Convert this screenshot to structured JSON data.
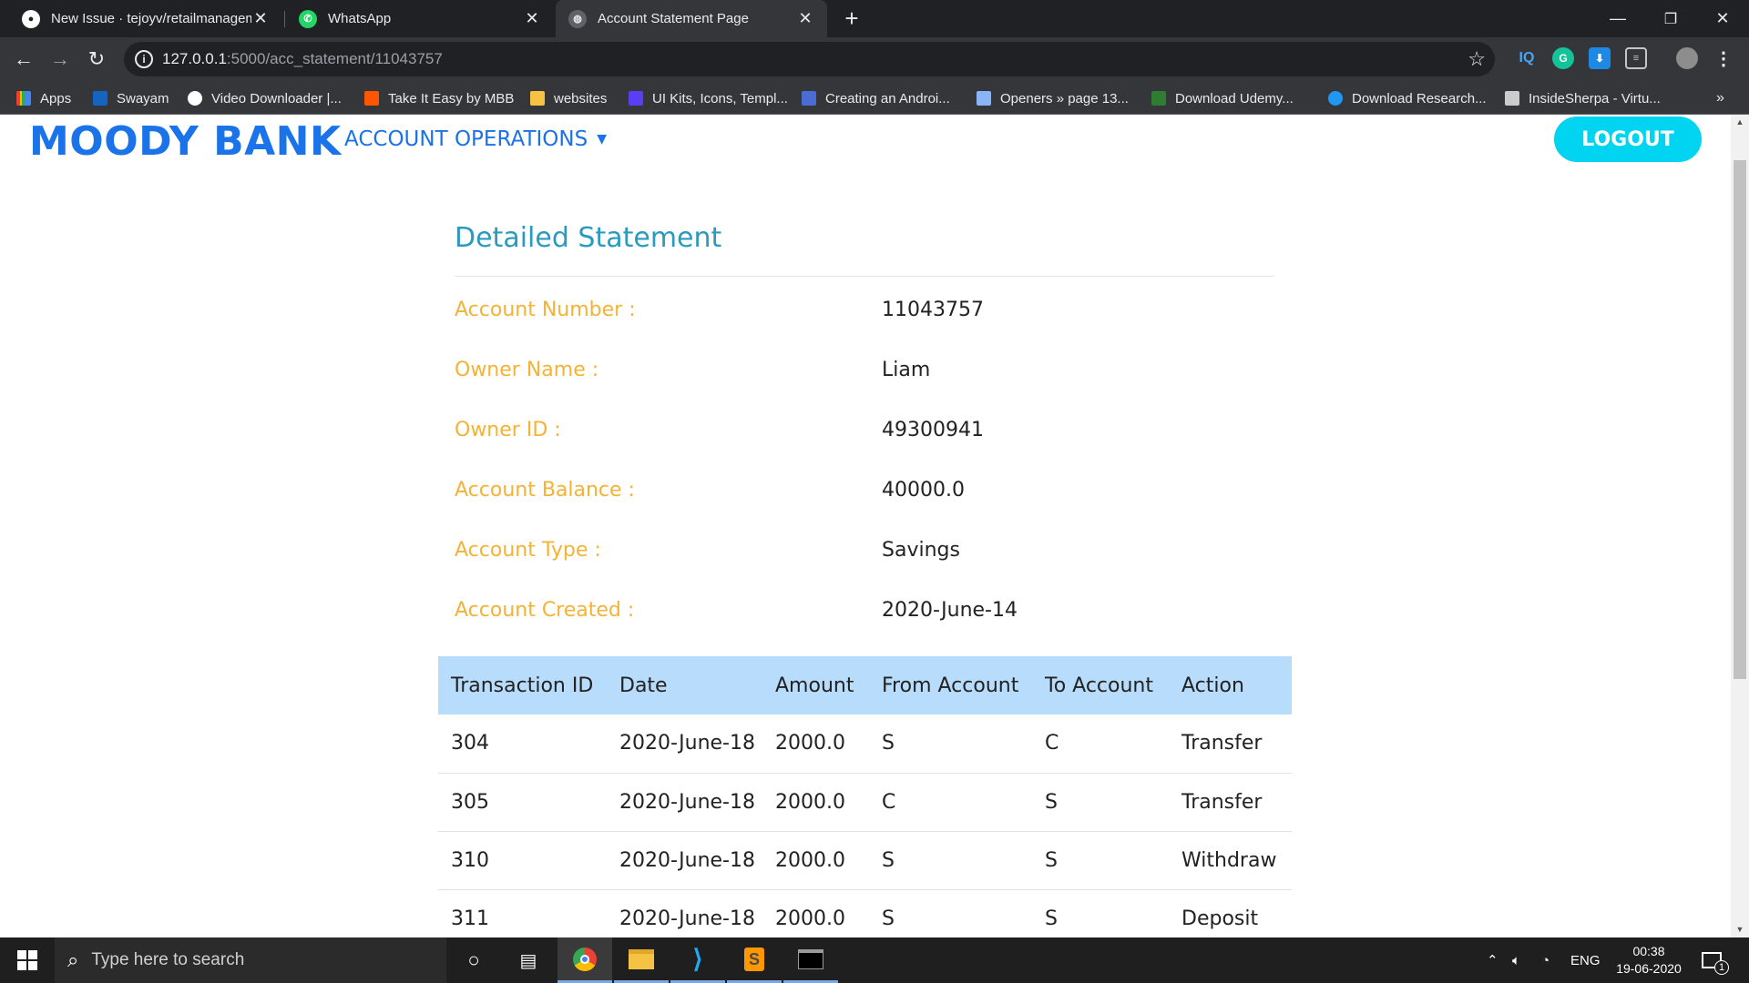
{
  "browser": {
    "tabs": [
      {
        "title": "New Issue · tejoyv/retailmanagem",
        "favicon": "github-icon"
      },
      {
        "title": "WhatsApp",
        "favicon": "whatsapp-icon"
      },
      {
        "title": "Account Statement Page",
        "favicon": "globe-icon",
        "active": true
      }
    ],
    "url_host": "127.0.0.1",
    "url_path": ":5000/acc_statement/11043757",
    "bookmarks": [
      {
        "label": "Apps",
        "color": "#4285f4"
      },
      {
        "label": "Swayam",
        "color": "#1565c0"
      },
      {
        "label": "Video Downloader |...",
        "color": "#ffffff"
      },
      {
        "label": "Take It Easy by MBB",
        "color": "#ff5500"
      },
      {
        "label": "websites",
        "color": "#f6c244"
      },
      {
        "label": "UI Kits, Icons, Templ...",
        "color": "#5b3df5"
      },
      {
        "label": "Creating an Androi...",
        "color": "#4a6cd4"
      },
      {
        "label": "Openers » page 13...",
        "color": "#8ab4f8"
      },
      {
        "label": "Download Udemy...",
        "color": "#2e7d32"
      },
      {
        "label": "Download Research...",
        "color": "#2196f3"
      },
      {
        "label": "InsideSherpa - Virtu...",
        "color": "#cccccc"
      }
    ],
    "more_bookmarks": "»"
  },
  "nav": {
    "brand": "MOODY BANK",
    "menu": "ACCOUNT OPERATIONS",
    "logout": "LOGOUT"
  },
  "statement": {
    "heading": "Detailed Statement",
    "fields": [
      {
        "label": "Account Number :",
        "value": "11043757"
      },
      {
        "label": "Owner Name :",
        "value": "Liam"
      },
      {
        "label": "Owner ID :",
        "value": "49300941"
      },
      {
        "label": "Account Balance :",
        "value": "40000.0"
      },
      {
        "label": "Account Type :",
        "value": "Savings"
      },
      {
        "label": "Account Created :",
        "value": "2020-June-14"
      }
    ]
  },
  "transactions": {
    "headers": [
      "Transaction ID",
      "Date",
      "Amount",
      "From Account",
      "To Account",
      "Action"
    ],
    "rows": [
      [
        "304",
        "2020-June-18",
        "2000.0",
        "S",
        "C",
        "Transfer"
      ],
      [
        "305",
        "2020-June-18",
        "2000.0",
        "C",
        "S",
        "Transfer"
      ],
      [
        "310",
        "2020-June-18",
        "2000.0",
        "S",
        "S",
        "Withdraw"
      ],
      [
        "311",
        "2020-June-18",
        "2000.0",
        "S",
        "S",
        "Deposit"
      ]
    ]
  },
  "taskbar": {
    "search_placeholder": "Type here to search",
    "language": "ENG",
    "time": "00:38",
    "date": "19-06-2020",
    "notifications": "1"
  },
  "colors": {
    "brand": "#1a73e8",
    "label": "#f5b335",
    "heading": "#2a9bbf",
    "logout": "#00d4f0",
    "table_header": "#b8dcfb"
  }
}
